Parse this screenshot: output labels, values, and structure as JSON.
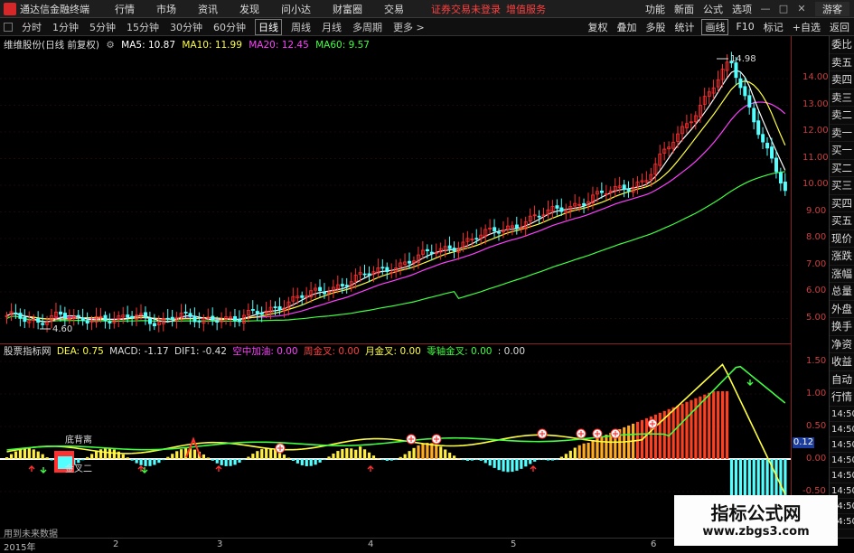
{
  "app": {
    "title": "通达信金融终端"
  },
  "menu": [
    "行情",
    "市场",
    "资讯",
    "发现",
    "问小达",
    "财富圈",
    "交易"
  ],
  "login_notice": "证券交易未登录",
  "login_link": "增值服务",
  "right_menu": [
    "功能",
    "新面",
    "公式",
    "选项"
  ],
  "guest_label": "游客",
  "periods": [
    "分时",
    "1分钟",
    "5分钟",
    "15分钟",
    "30分钟",
    "60分钟",
    "日线",
    "周线",
    "月线",
    "多周期",
    "更多 >"
  ],
  "active_period": "日线",
  "toolbar": [
    "复权",
    "叠加",
    "多股",
    "统计",
    "画线",
    "F10",
    "标记",
    "+自选",
    "返回"
  ],
  "active_tool": "画线",
  "stock_label": "维维股份(日线 前复权)",
  "ma": {
    "ma5": "MA5: 10.87",
    "ma10": "MA10: 11.99",
    "ma20": "MA20: 12.45",
    "ma60": "MA60: 9.57"
  },
  "price_axis": [
    "14.00",
    "13.00",
    "12.00",
    "11.00",
    "10.00",
    "9.00",
    "8.00",
    "7.00",
    "6.00",
    "5.00"
  ],
  "max_label": "14.98",
  "min_label": "4.60",
  "ind": {
    "name": "股票指标网",
    "dea": "DEA: 0.75",
    "macd": "MACD: -1.17",
    "dif": "DIF1: -0.42",
    "kzjc": "空中加油: 0.00",
    "zjc": "周金叉: 0.00",
    "yjc": "月金叉: 0.00",
    "lzjc": "零轴金叉: 0.00",
    "extra": ": 0.00"
  },
  "ind_axis": [
    "1.50",
    "1.00",
    "0.50",
    "0.00",
    "-0.50"
  ],
  "ind_value_box": "0.12",
  "ann": {
    "dbl": "底背离",
    "jc2": "金叉二"
  },
  "side_buttons": [
    "委比",
    "卖五",
    "卖四",
    "卖三",
    "卖二",
    "卖一",
    "买一",
    "买二",
    "买三",
    "买四",
    "买五",
    "现价",
    "涨跌",
    "涨幅",
    "总量",
    "外盘",
    "换手",
    "净资",
    "收益",
    "自动",
    "行情",
    "14:50",
    "14:50",
    "14:50",
    "14:50",
    "14:50",
    "14:50",
    "14:50",
    "14:50"
  ],
  "time_labels": [
    "2015年",
    "2",
    "3",
    "4",
    "5",
    "6"
  ],
  "future_note": "用到未来数据",
  "watermark": {
    "title": "指标公式网",
    "url": "www.zbgs3.com"
  },
  "colors": {
    "up": "#ff3030",
    "down": "#54ffff",
    "ma5": "#ffffff",
    "ma10": "#ffff40",
    "ma20": "#ff40ff",
    "ma60": "#40ff40"
  }
}
